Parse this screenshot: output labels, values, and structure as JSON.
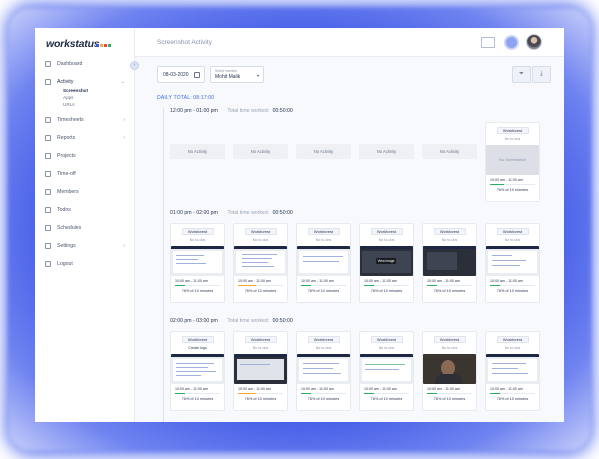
{
  "app": {
    "logo_text": "workstatus",
    "logo_colors": [
      "#3b55e6",
      "#f2b233",
      "#e8483a",
      "#2fb36b"
    ],
    "page_title": "Screenshot Activity"
  },
  "sidebar": {
    "items": [
      {
        "label": "Dashboard",
        "icon": "dashboard-icon"
      },
      {
        "label": "Activity",
        "icon": "activity-icon",
        "expanded": true,
        "children": [
          {
            "label": "Screenshot",
            "current": true
          },
          {
            "label": "Apps"
          },
          {
            "label": "URLs"
          }
        ]
      },
      {
        "label": "Timesheets",
        "icon": "timesheets-icon",
        "has_children": true
      },
      {
        "label": "Reports",
        "icon": "reports-icon",
        "has_children": true
      },
      {
        "label": "Projects",
        "icon": "projects-icon"
      },
      {
        "label": "Time-off",
        "icon": "time-off-icon"
      },
      {
        "label": "Members",
        "icon": "members-icon"
      },
      {
        "label": "Todos",
        "icon": "todos-icon"
      },
      {
        "label": "Schedules",
        "icon": "schedules-icon"
      },
      {
        "label": "Settings",
        "icon": "settings-icon",
        "has_children": true
      },
      {
        "label": "Logout",
        "icon": "logout-icon"
      }
    ]
  },
  "filters": {
    "date": "08-03-2020",
    "employee_label": "Select member",
    "employee": "Mohit Malik"
  },
  "daily_total": "DAILY TOTAL: 08:17:00",
  "blocks": [
    {
      "range": "12:00 pm - 01:00 pm",
      "worked_label": "Total time worked:",
      "worked": "00:50:00",
      "no_activity": [
        "No Activity",
        "No Activity",
        "No Activity",
        "No Activity",
        "No Activity"
      ],
      "cards": [
        {
          "project": "Workforest",
          "todo": "No to-dos",
          "screenshot": "No Screenshot",
          "time": "10:00 am - 11:00 am",
          "pct": "76% of 10 minutes",
          "color": "#27ae60"
        }
      ]
    },
    {
      "range": "01:00 pm - 02:00 pm",
      "worked_label": "Total time worked:",
      "worked": "00:50:00",
      "cards": [
        {
          "project": "Workforest",
          "todo": "No to-dos",
          "time": "10:00 am - 11:00 am",
          "pct": "76% of 10 minutes",
          "color": "#27ae60"
        },
        {
          "project": "Workforest",
          "todo": "No to-dos",
          "time": "10:00 am - 11:00 am",
          "pct": "76% of 10 minutes",
          "color": "#f5a623"
        },
        {
          "project": "Workforest",
          "todo": "No to-dos",
          "time": "10:00 am - 11:00 am",
          "pct": "76% of 10 minutes",
          "color": "#27ae60"
        },
        {
          "project": "Workforest",
          "todo": "No to-dos",
          "view_label": "View image",
          "time": "10:00 am - 11:00 am",
          "pct": "76% of 10 minutes",
          "color": "#27ae60"
        },
        {
          "project": "Workforest",
          "todo": "No to-dos",
          "time": "10:00 am - 11:00 am",
          "pct": "76% of 10 minutes",
          "color": "#27ae60"
        },
        {
          "project": "Workforest",
          "todo": "No to-dos",
          "time": "10:00 am - 11:00 am",
          "pct": "76% of 10 minutes",
          "color": "#27ae60"
        }
      ]
    },
    {
      "range": "02:00 pm - 03:00 pm",
      "worked_label": "Total time worked:",
      "worked": "00:50:00",
      "cards": [
        {
          "project": "Workforest",
          "todo": "Create logo",
          "time": "10:00 am - 11:00 am",
          "pct": "76% of 10 minutes",
          "color": "#27ae60"
        },
        {
          "project": "Workforest",
          "todo": "No to-dos",
          "time": "10:00 am - 11:00 am",
          "pct": "76% of 10 minutes",
          "color": "#f5a623"
        },
        {
          "project": "Workforest",
          "todo": "No to-dos",
          "time": "10:00 am - 11:00 am",
          "pct": "76% of 10 minutes",
          "color": "#27ae60"
        },
        {
          "project": "Workforest",
          "todo": "No to-dos",
          "time": "10:00 am - 11:00 am",
          "pct": "76% of 10 minutes",
          "color": "#27ae60"
        },
        {
          "project": "Workforest",
          "todo": "No to-dos",
          "time": "10:00 am - 11:00 am",
          "pct": "76% of 10 minutes",
          "color": "#27ae60"
        },
        {
          "project": "Workforest",
          "todo": "No to-dos",
          "time": "10:00 am - 11:00 am",
          "pct": "76% of 10 minutes",
          "color": "#27ae60"
        }
      ]
    }
  ]
}
